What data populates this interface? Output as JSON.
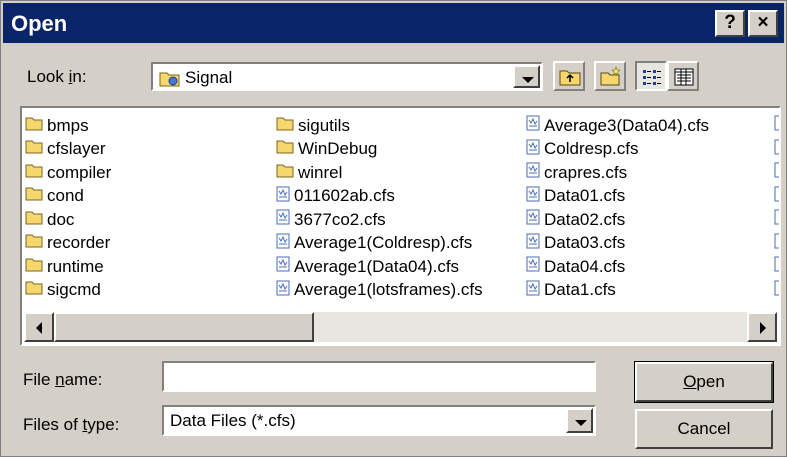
{
  "window": {
    "title": "Open",
    "help_label": "?",
    "close_label": "×"
  },
  "look_in": {
    "label_pre": "Look ",
    "label_key": "i",
    "label_post": "n:",
    "value": "Signal"
  },
  "files": {
    "col1": [
      {
        "name": "bmps",
        "type": "folder"
      },
      {
        "name": "cfslayer",
        "type": "folder"
      },
      {
        "name": "compiler",
        "type": "folder"
      },
      {
        "name": "cond",
        "type": "folder"
      },
      {
        "name": "doc",
        "type": "folder"
      },
      {
        "name": "recorder",
        "type": "folder"
      },
      {
        "name": "runtime",
        "type": "folder"
      },
      {
        "name": "sigcmd",
        "type": "folder"
      }
    ],
    "col2": [
      {
        "name": "sigutils",
        "type": "folder"
      },
      {
        "name": "WinDebug",
        "type": "folder"
      },
      {
        "name": "winrel",
        "type": "folder"
      },
      {
        "name": "011602ab.cfs",
        "type": "file"
      },
      {
        "name": "3677co2.cfs",
        "type": "file"
      },
      {
        "name": "Average1(Coldresp).cfs",
        "type": "file"
      },
      {
        "name": "Average1(Data04).cfs",
        "type": "file"
      },
      {
        "name": "Average1(lotsframes).cfs",
        "type": "file"
      }
    ],
    "col3": [
      {
        "name": "Average3(Data04).cfs",
        "type": "file"
      },
      {
        "name": "Coldresp.cfs",
        "type": "file"
      },
      {
        "name": "crapres.cfs",
        "type": "file"
      },
      {
        "name": "Data01.cfs",
        "type": "file"
      },
      {
        "name": "Data02.cfs",
        "type": "file"
      },
      {
        "name": "Data03.cfs",
        "type": "file"
      },
      {
        "name": "Data04.cfs",
        "type": "file"
      },
      {
        "name": "Data1.cfs",
        "type": "file"
      }
    ]
  },
  "file_name": {
    "label_pre": "File ",
    "label_key": "n",
    "label_post": "ame:",
    "value": ""
  },
  "file_type": {
    "label_pre": "Files of ",
    "label_key": "t",
    "label_post": "ype:",
    "value": "Data Files (*.cfs)"
  },
  "buttons": {
    "open_key": "O",
    "open_rest": "pen",
    "cancel": "Cancel"
  },
  "colors": {
    "titlebar": "#0a246a",
    "face": "#d4d0c8",
    "folder": "#f5d76e",
    "file_icon": "#4a6fb5"
  },
  "icons": [
    "folder-icon",
    "cfs-file-icon",
    "up-folder-icon",
    "new-folder-icon",
    "list-view-icon",
    "details-view-icon"
  ]
}
